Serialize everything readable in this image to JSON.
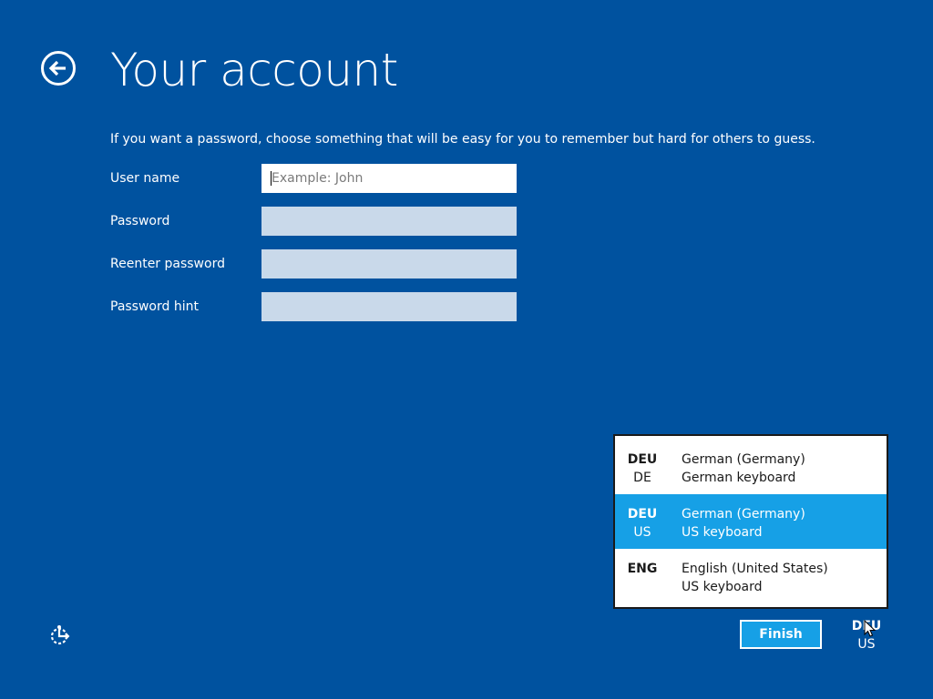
{
  "header": {
    "title": "Your account"
  },
  "instructions": "If you want a password, choose something that will be easy for you to remember but hard for others to guess.",
  "form": {
    "username": {
      "label": "User name",
      "value": "",
      "placeholder": "Example: John"
    },
    "password": {
      "label": "Password",
      "value": ""
    },
    "reenter_password": {
      "label": "Reenter password",
      "value": ""
    },
    "password_hint": {
      "label": "Password hint",
      "value": ""
    }
  },
  "language_menu": {
    "items": [
      {
        "code": "DEU",
        "sub": "DE",
        "language": "German (Germany)",
        "keyboard": "German keyboard",
        "selected": false
      },
      {
        "code": "DEU",
        "sub": "US",
        "language": "German (Germany)",
        "keyboard": "US keyboard",
        "selected": true
      },
      {
        "code": "ENG",
        "sub": "",
        "language": "English (United States)",
        "keyboard": "US keyboard",
        "selected": false
      }
    ]
  },
  "footer": {
    "finish_label": "Finish",
    "lang_indicator": {
      "code": "DEU",
      "sub": "US"
    }
  },
  "colors": {
    "background": "#00529f",
    "accent": "#16a0e6",
    "input_inactive": "#c9d9ea"
  },
  "icons": {
    "back": "back-arrow-icon",
    "ease_of_access": "ease-of-access-icon",
    "cursor": "mouse-pointer-icon"
  }
}
